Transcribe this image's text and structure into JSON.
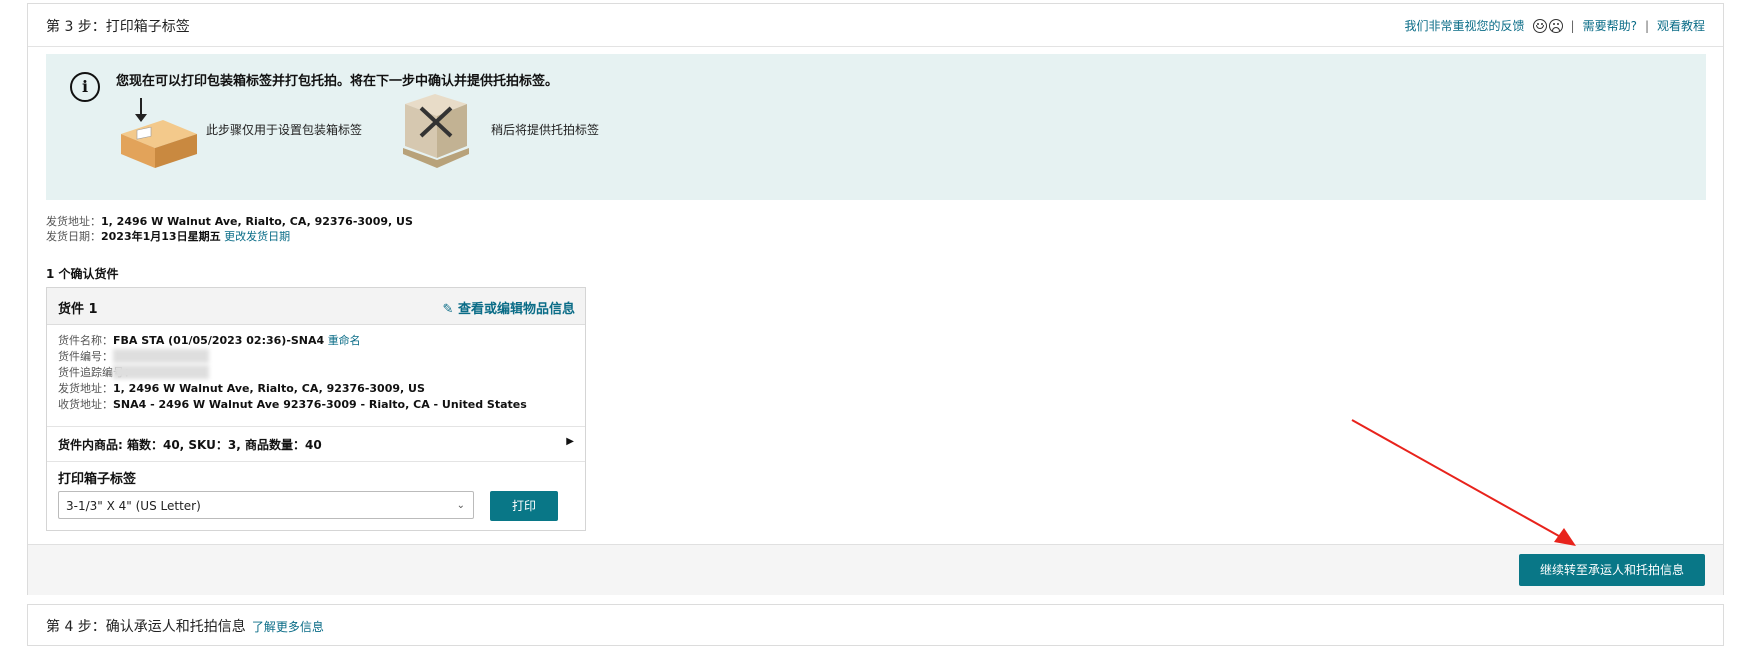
{
  "step3": {
    "title": "第 3 步：打印箱子标签",
    "feedback_text": "我们非常重视您的反馈",
    "help_link": "需要帮助?",
    "tutorial_link": "观看教程",
    "info": {
      "title": "您现在可以打印包装箱标签并打包托拍。将在下一步中确认并提供托拍标签。",
      "box_caption": "此步骤仅用于设置包装箱标签",
      "pallet_caption": "稍后将提供托拍标签"
    },
    "ship_from_label": "发货地址：",
    "ship_from_value": "1, 2496 W Walnut Ave, Rialto, CA, 92376-3009, US",
    "ship_date_label": "发货日期：",
    "ship_date_value": "2023年1月13日星期五",
    "change_date_link": "更改发货日期",
    "confirm_count": "1 个确认货件",
    "shipment": {
      "title": "货件 1",
      "edit_link": "查看或编辑物品信息",
      "name_label": "货件名称：",
      "name_value": "FBA STA (01/05/2023 02:36)-SNA4",
      "rename_link": "重命名",
      "id_label": "货件编号：",
      "tracking_label": "货件追踪编号：",
      "from_label": "发货地址：",
      "from_value": "1, 2496 W Walnut Ave, Rialto, CA, 92376-3009, US",
      "to_label": "收货地址：",
      "to_value": "SNA4 - 2496 W Walnut Ave 92376-3009 - Rialto, CA - United States",
      "contents": "货件内商品: 箱数：40, SKU：3, 商品数量：40",
      "print_label": "打印箱子标签",
      "select_value": "3-1/3\" X 4\" (US Letter)",
      "print_button": "打印"
    },
    "continue_button": "继续转至承运人和托拍信息"
  },
  "step4": {
    "title": "第 4 步：确认承运人和托拍信息",
    "learn_more": "了解更多信息"
  },
  "colors": {
    "accent": "#097787",
    "link": "#0a6c87",
    "info_bg": "#e6f2f2",
    "annotation_arrow": "#e8231c"
  }
}
